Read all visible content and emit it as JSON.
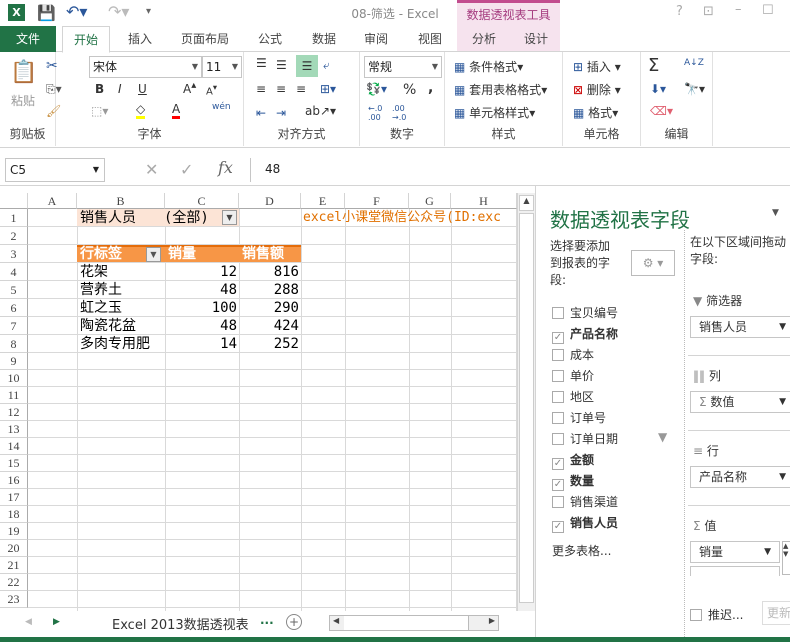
{
  "window": {
    "title": "08-筛选 - Excel",
    "context_tab_group": "数据透视表工具"
  },
  "tabs": [
    "文件",
    "开始",
    "插入",
    "页面布局",
    "公式",
    "数据",
    "审阅",
    "视图",
    "分析",
    "设计"
  ],
  "ribbon": {
    "clipboard": {
      "paste": "粘贴",
      "label": "剪贴板"
    },
    "font": {
      "name": "宋体",
      "size": "11",
      "bold": "B",
      "italic": "I",
      "underline": "U",
      "phonetic": "wén",
      "label": "字体",
      "fill_color": "#ffff00",
      "font_color": "#ff0000"
    },
    "alignment": {
      "label": "对齐方式"
    },
    "number": {
      "format": "常规",
      "percent": "%",
      "comma": ",",
      "inc": "←.0\n.00",
      "dec": ".00\n→.0",
      "label": "数字"
    },
    "styles": {
      "conditional": "条件格式",
      "table": "套用表格格式",
      "cell": "单元格样式",
      "label": "样式"
    },
    "cells": {
      "insert": "插入",
      "delete": "删除",
      "format": "格式",
      "label": "单元格"
    },
    "editing": {
      "sum": "Σ",
      "sort": "A↓Z",
      "label": "编辑"
    }
  },
  "formula_bar": {
    "name_box": "C5",
    "fx": "fx",
    "value": "48"
  },
  "columns": [
    "A",
    "B",
    "C",
    "D",
    "E",
    "F",
    "G",
    "H"
  ],
  "rows": [
    "1",
    "2",
    "3",
    "4",
    "5",
    "6",
    "7",
    "8",
    "9",
    "10",
    "11",
    "12",
    "13",
    "14",
    "15",
    "16",
    "17",
    "18",
    "19",
    "20",
    "21",
    "22",
    "23"
  ],
  "pivot": {
    "filter_label": "销售人员",
    "filter_value": "(全部)",
    "headers": [
      "行标签",
      "销量",
      "销售额"
    ],
    "data": [
      [
        "花架",
        "12",
        "816"
      ],
      [
        "营养土",
        "48",
        "288"
      ],
      [
        "虹之玉",
        "100",
        "290"
      ],
      [
        "陶瓷花盆",
        "48",
        "424"
      ],
      [
        "多肉专用肥",
        "14",
        "252"
      ]
    ]
  },
  "note": "excel小课堂微信公众号(ID:exc",
  "sheet_tab": "Excel 2013数据透视表",
  "sheet_more": "...",
  "field_pane": {
    "title": "数据透视表字段",
    "choose_label": "选择要添加到报表的字段:",
    "drag_label": "在以下区域间拖动字段:",
    "fields": [
      {
        "name": "宝贝编号",
        "checked": false
      },
      {
        "name": "产品名称",
        "checked": true
      },
      {
        "name": "成本",
        "checked": false
      },
      {
        "name": "单价",
        "checked": false
      },
      {
        "name": "地区",
        "checked": false
      },
      {
        "name": "订单号",
        "checked": false
      },
      {
        "name": "订单日期",
        "checked": false
      },
      {
        "name": "金额",
        "checked": true
      },
      {
        "name": "数量",
        "checked": true
      },
      {
        "name": "销售渠道",
        "checked": false
      },
      {
        "name": "销售人员",
        "checked": true
      }
    ],
    "more_tables": "更多表格...",
    "areas": {
      "filters": "筛选器",
      "filters_item": "销售人员",
      "columns": "列",
      "columns_item": "数值",
      "rows": "行",
      "rows_item": "产品名称",
      "values": "值",
      "values_item": "销量"
    },
    "defer": "推迟...",
    "update": "更新"
  }
}
